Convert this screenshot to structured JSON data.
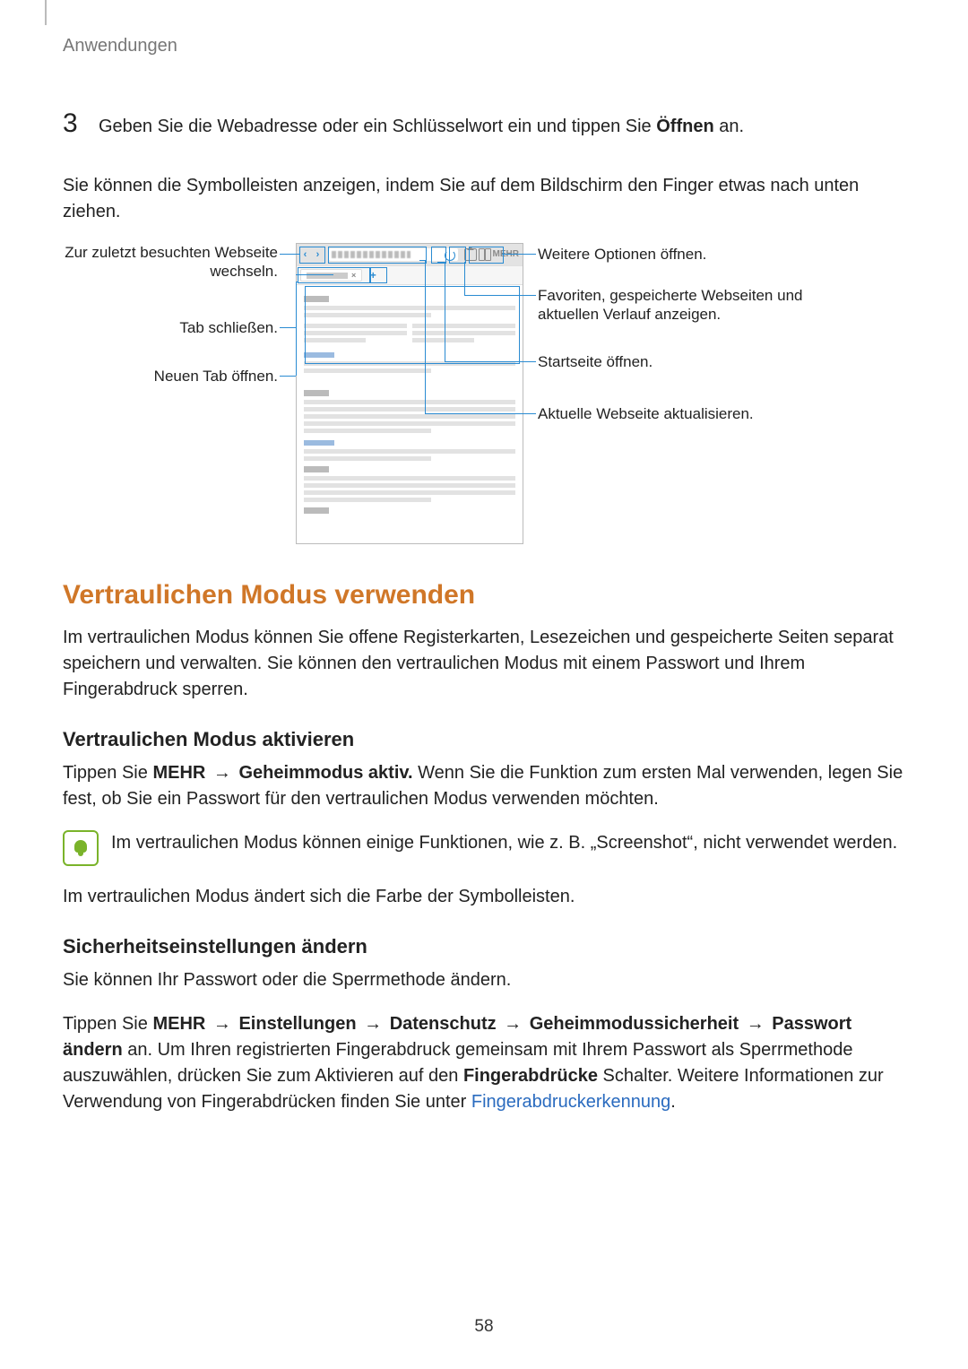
{
  "breadcrumb": "Anwendungen",
  "step3": {
    "num": "3",
    "prefix": "Geben Sie die Webadresse oder ein Schlüsselwort ein und tippen Sie ",
    "bold": "Öffnen",
    "suffix": " an."
  },
  "intro": "Sie können die Symbolleisten anzeigen, indem Sie auf dem Bildschirm den Finger etwas nach unten ziehen.",
  "diagram": {
    "left": {
      "back_forward": "Zur zuletzt besuchten Webseite wechseln.",
      "close_tab": "Tab schließen.",
      "new_tab": "Neuen Tab öffnen."
    },
    "right": {
      "more": "Weitere Optionen öffnen.",
      "bookmarks": "Favoriten, gespeicherte Webseiten und aktuellen Verlauf anzeigen.",
      "home": "Startseite öffnen.",
      "refresh": "Aktuelle Webseite aktualisieren."
    },
    "tab_label": "—",
    "more_label": "MEHR"
  },
  "h2": "Vertraulichen Modus verwenden",
  "para_priv": "Im vertraulichen Modus können Sie offene Registerkarten, Lesezeichen und gespeicherte Seiten separat speichern und verwalten. Sie können den vertraulichen Modus mit einem Passwort und Ihrem Fingerabdruck sperren.",
  "h3a": "Vertraulichen Modus aktivieren",
  "activate": {
    "p1_pre": "Tippen Sie ",
    "p1_b1": "MEHR",
    "p1_arrow": " → ",
    "p1_b2": "Geheimmodus aktiv.",
    "p1_post": " Wenn Sie die Funktion zum ersten Mal verwenden, legen Sie fest, ob Sie ein Passwort für den vertraulichen Modus verwenden möchten."
  },
  "note": "Im vertraulichen Modus können einige Funktionen, wie z. B. „Screenshot“, nicht verwendet werden.",
  "para_color": "Im vertraulichen Modus ändert sich die Farbe der Symbolleisten.",
  "h3b": "Sicherheitseinstellungen ändern",
  "sec_intro": "Sie können Ihr Passwort oder die Sperrmethode ändern.",
  "sec": {
    "pre": "Tippen Sie ",
    "b1": "MEHR",
    "a1": " → ",
    "b2": "Einstellungen",
    "a2": " → ",
    "b3": "Datenschutz",
    "a3": " → ",
    "b4": "Geheimmodussicherheit",
    "a4": " → ",
    "b5": "Passwort ändern",
    "mid1": " an. Um Ihren registrierten Fingerabdruck gemeinsam mit Ihrem Passwort als Sperrmethode auszuwählen, drücken Sie zum Aktivieren auf den ",
    "b6": "Fingerabdrücke",
    "mid2": " Schalter. Weitere Informationen zur Verwendung von Fingerabdrücken finden Sie unter ",
    "link": "Fingerabdruckerkennung",
    "end": "."
  },
  "page_number": "58"
}
